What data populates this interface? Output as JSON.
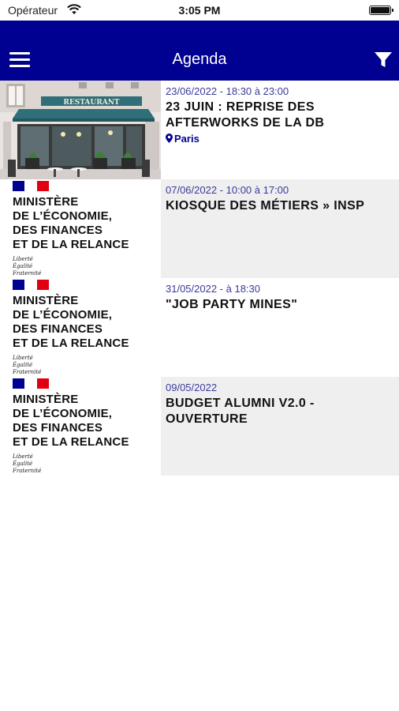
{
  "status": {
    "carrier": "Opérateur",
    "time": "3:05 PM",
    "battery_level": 1.0
  },
  "nav": {
    "title": "Agenda",
    "menu_icon": "hamburger-menu-icon",
    "filter_icon": "filter-icon",
    "color": "#000091"
  },
  "thumbs": {
    "restaurant_sign": "RESTAURANT",
    "ministry": {
      "line1": "MINISTÈRE",
      "line2": "DE L’ÉCONOMIE,",
      "line3": "DES FINANCES",
      "line4": "ET DE LA RELANCE",
      "motto1": "Liberté",
      "motto2": "Égalité",
      "motto3": "Fraternité"
    }
  },
  "events": [
    {
      "date": "23/06/2022 - 18:30 à 23:00",
      "title_line1": "23 JUIN : REPRISE DES",
      "title_line2": "AFTERWORKS DE LA DB",
      "location": "Paris",
      "thumb": "restaurant"
    },
    {
      "date": "07/06/2022 - 10:00 à 17:00",
      "title_line1": "KIOSQUE DES MÉTIERS » INSP",
      "title_line2": "",
      "location": "",
      "thumb": "ministry"
    },
    {
      "date": "31/05/2022 - à 18:30",
      "title_line1": "\"JOB PARTY MINES\"",
      "title_line2": "",
      "location": "",
      "thumb": "ministry"
    },
    {
      "date": "09/05/2022",
      "title_line1": "BUDGET ALUMNI V2.0 -",
      "title_line2": "OUVERTURE",
      "location": "",
      "thumb": "ministry"
    }
  ]
}
